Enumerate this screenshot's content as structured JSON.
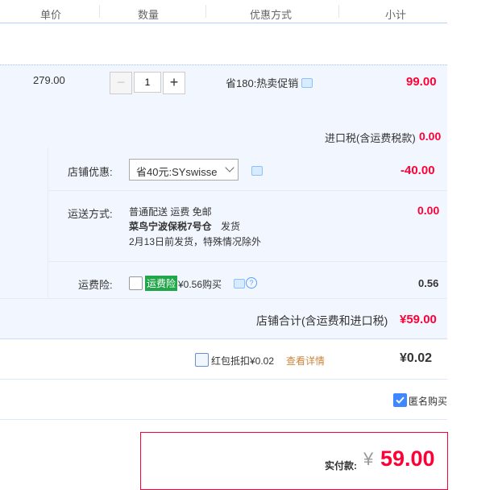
{
  "header": {
    "columns": [
      "单价",
      "数量",
      "优惠方式",
      "小计"
    ]
  },
  "item": {
    "unit_price": "279.00",
    "quantity": "1",
    "promotion": "省180:热卖促销",
    "subtotal": "99.00",
    "tax_label": "进口税(含运费税款)",
    "tax_value": "0.00"
  },
  "shop": {
    "discount_label": "店铺优惠:",
    "discount_selected": "省40元:SYswisse",
    "discount_value": "-40.00",
    "shipping_label": "运送方式:",
    "shipping_line1": "普通配送 运费 免邮",
    "shipping_line2_bold": "菜鸟宁波保税7号仓",
    "shipping_line2_rest": "发货",
    "shipping_line3": "2月13日前发货，特殊情况除外",
    "shipping_value": "0.00",
    "insurance_label": "运费险:",
    "insurance_badge": "运费险",
    "insurance_price": "¥0.56购买",
    "insurance_value": "0.56",
    "total_label": "店铺合计(含运费和进口税)",
    "total_value": "¥59.00"
  },
  "redpacket": {
    "label": "红包抵扣¥0.02",
    "details_link": "查看详情",
    "value": "¥0.02"
  },
  "anonymous": {
    "label": "匿名购买",
    "checked": true
  },
  "payment": {
    "label": "实付款:",
    "currency": "¥",
    "amount": "59.00"
  },
  "colors": {
    "accent_red": "#ff0036",
    "accent_blue": "#3f87ff",
    "row_bg": "#f2f7ff",
    "badge_green": "#22a64a"
  }
}
